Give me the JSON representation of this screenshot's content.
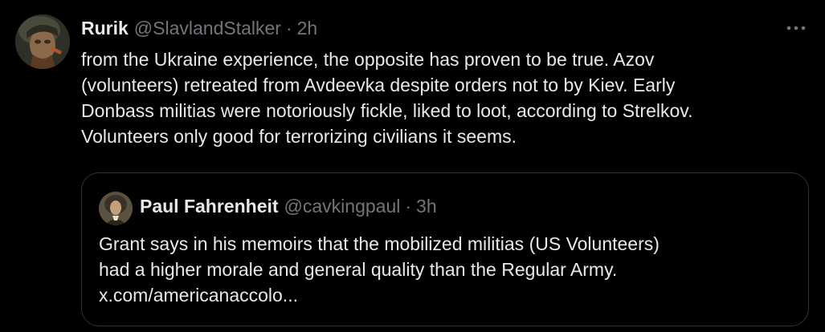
{
  "tweet": {
    "display_name": "Rurik",
    "handle": "@SlavlandStalker",
    "separator": "·",
    "time": "2h",
    "text": "from the Ukraine experience, the opposite has proven to be true. Azov\n(volunteers) retreated from Avdeevka despite orders not to by Kiev. Early\nDonbass militias were notoriously fickle, liked to loot, according to Strelkov.\nVolunteers only good for terrorizing civilians it seems.",
    "more_icon": "more-horizontal-icon"
  },
  "quoted_tweet": {
    "display_name": "Paul Fahrenheit",
    "handle": "@cavkingpaul",
    "separator": "·",
    "time": "3h",
    "text": "Grant says in his memoirs that the mobilized militias (US Volunteers)\nhad a higher morale and general quality than the Regular Army.\nx.com/americanaccolo..."
  },
  "colors": {
    "background": "#000000",
    "primary_text": "#e7e9ea",
    "secondary_text": "#71767b",
    "border": "#2f3336"
  }
}
